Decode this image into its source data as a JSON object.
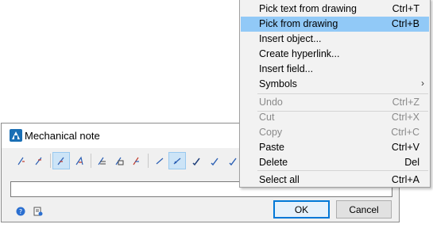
{
  "dialog": {
    "title": "Mechanical note",
    "input_value": "",
    "ok_label": "OK",
    "cancel_label": "Cancel",
    "toolbar_icons": [
      "leader-arrow-icon",
      "leader-arrow-2-icon",
      "leader-arrow-3-icon",
      "leader-arrow-4-icon",
      "text-leader-icon",
      "text-leader-2-icon",
      "text-leader-3-icon",
      "line-icon",
      "line-arrow-icon",
      "check-arrow-icon",
      "check-arrow-2-icon",
      "check-arrow-3-icon"
    ],
    "selected_toolbar_icons": [
      "leader-arrow-3-icon",
      "line-arrow-icon"
    ]
  },
  "context_menu": {
    "items": [
      {
        "label": "Pick text from drawing",
        "shortcut": "Ctrl+T",
        "state": "normal"
      },
      {
        "label": "Pick from drawing",
        "shortcut": "Ctrl+B",
        "state": "highlighted"
      },
      {
        "label": "Insert object...",
        "shortcut": "",
        "state": "normal"
      },
      {
        "label": "Create hyperlink...",
        "shortcut": "",
        "state": "normal"
      },
      {
        "label": "Insert field...",
        "shortcut": "",
        "state": "normal"
      },
      {
        "label": "Symbols",
        "shortcut": "",
        "state": "submenu"
      },
      {
        "label": "Undo",
        "shortcut": "Ctrl+Z",
        "state": "disabled"
      },
      {
        "label": "Cut",
        "shortcut": "Ctrl+X",
        "state": "disabled"
      },
      {
        "label": "Copy",
        "shortcut": "Ctrl+C",
        "state": "disabled"
      },
      {
        "label": "Paste",
        "shortcut": "Ctrl+V",
        "state": "normal"
      },
      {
        "label": "Delete",
        "shortcut": "Del",
        "state": "normal"
      },
      {
        "label": "Select all",
        "shortcut": "Ctrl+A",
        "state": "normal"
      }
    ]
  },
  "colors": {
    "menu_highlight": "#91c9f7",
    "disabled_text": "#8a8a8a",
    "default_button_border": "#0078d7",
    "icon_blue": "#2b5fb4",
    "icon_red": "#c0392b"
  }
}
